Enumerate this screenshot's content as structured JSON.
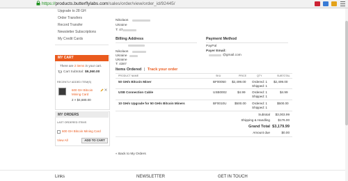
{
  "browser": {
    "url_scheme": "https://",
    "url_host": "products.butterflylabs.com",
    "url_path": "/sales/order/view/order_id/92445/"
  },
  "sidebar": {
    "links": [
      "Upgrade to 28 GH",
      "Order Transfers",
      "Record Transfer",
      "Newsletter Subscriptions",
      "My Credit Cards"
    ],
    "cart": {
      "title": "MY CART",
      "summary_pre": "There are",
      "summary_items": "2 items",
      "summary_post": "in your cart.",
      "subtotal_label": "Cart Subtotal:",
      "subtotal_value": "$9,360.00",
      "recent_label": "RECENTLY ADDED ITEM(S)",
      "item_name_1": "600 GH Bitcoin",
      "item_name_2": "Mining Card",
      "item_qty_price": "2 × $4,680.00"
    },
    "orders": {
      "title": "MY ORDERS",
      "last_label": "LAST ORDERED ITEMS",
      "item": "600 GH Bitcoin Mining Card",
      "view_all": "View All",
      "add_to_cart": "ADD TO CART"
    }
  },
  "shipping": {
    "line1": "Nikolaos",
    "line2": "Ukraine",
    "line3": "T: 47"
  },
  "billing": {
    "title": "Billing Address",
    "line1": "Nikolaos",
    "line2": "Ukraine",
    "line3": "Ukraine",
    "line4": "T: 4387"
  },
  "payment": {
    "title": "Payment Method",
    "method": "PayPal",
    "payer_label": "Payer Email:",
    "payer_email": "@gmail.com"
  },
  "items": {
    "title": "Items Ordered",
    "separator": "|",
    "track": "Track your order",
    "headers": [
      "PRODUCT NAME",
      "SKU",
      "PRICE",
      "QTY",
      "SUBTOTAL"
    ],
    "rows": [
      {
        "name": "50 GH/s Bitcoin Miner",
        "sku": "BF00050",
        "price": "$2,499.00",
        "ordered": "Ordered: 1",
        "shipped": "Shipped: 1",
        "subtotal": "$2,499.00"
      },
      {
        "name": "USB Connection Cable",
        "sku": "USB0002",
        "price": "$4.99",
        "ordered": "Ordered: 1",
        "shipped": "Shipped: 1",
        "subtotal": "$4.99"
      },
      {
        "name": "10 GH/s Upgrade for 50 GH/s Bitcoin Miners",
        "sku": "BF0010U",
        "price": "$500.00",
        "ordered": "Ordered: 1",
        "shipped": "Shipped: 1",
        "subtotal": "$500.00"
      }
    ],
    "totals": [
      {
        "label": "Subtotal",
        "value": "$3,003.99"
      },
      {
        "label": "Shipping & Handling",
        "value": "$176.00"
      },
      {
        "label": "Grand Total",
        "value": "$3,179.99"
      },
      {
        "label": "Amount due",
        "value": "$0.00"
      }
    ]
  },
  "back_link": "« Back to My Orders",
  "footer": {
    "col1": "Links",
    "col2": "NEWSLETTER",
    "col3": "GET IN TOUCH"
  },
  "colors": {
    "accent": "#ea5a1d",
    "link": "#ea5a1d"
  }
}
